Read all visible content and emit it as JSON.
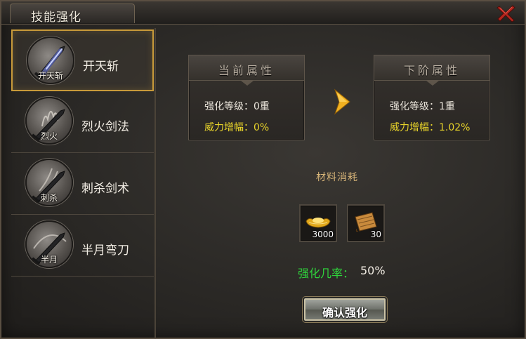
{
  "window": {
    "title": "技能强化"
  },
  "skills": [
    {
      "short": "开天斩",
      "name": "开天斩",
      "selected": true,
      "tint": "#6f7fff"
    },
    {
      "short": "烈火",
      "name": "烈火剑法",
      "selected": false,
      "tint": "#b9b4ad"
    },
    {
      "short": "刺杀",
      "name": "刺杀剑术",
      "selected": false,
      "tint": "#b9b4ad"
    },
    {
      "short": "半月",
      "name": "半月弯刀",
      "selected": false,
      "tint": "#b9b4ad"
    }
  ],
  "current_attrs": {
    "heading": "当前属性",
    "level_label": "强化等级：",
    "level_value": "0重",
    "power_label": "威力增幅：",
    "power_value": "0%"
  },
  "next_attrs": {
    "heading": "下阶属性",
    "level_label": "强化等级：",
    "level_value": "1重",
    "power_label": "威力增幅：",
    "power_value": "1.02%"
  },
  "materials": {
    "heading": "材料消耗",
    "items": [
      {
        "icon": "gold-ingot-icon",
        "count": "3000"
      },
      {
        "icon": "scroll-icon",
        "count": "30"
      }
    ]
  },
  "success_rate": {
    "label": "强化几率：",
    "value": "50%"
  },
  "confirm_button": {
    "label": "确认强化"
  },
  "colors": {
    "highlight_yellow": "#e8d42a",
    "rate_green": "#2fd23c",
    "selected_border": "#c89a3a",
    "arrow_gold": "#f0b020"
  }
}
